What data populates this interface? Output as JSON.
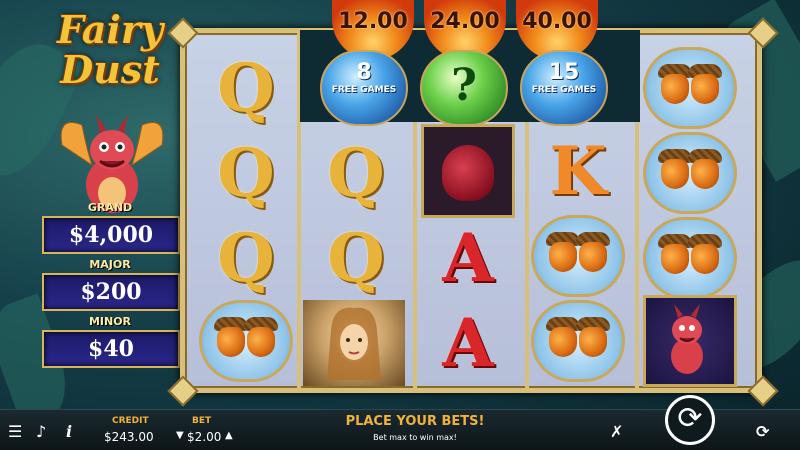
{
  "game": {
    "title_line1": "Fairy",
    "title_line2": "Dust"
  },
  "jackpots": [
    {
      "label": "GRAND",
      "value": "$4,000"
    },
    {
      "label": "MAJOR",
      "value": "$200"
    },
    {
      "label": "MINOR",
      "value": "$40"
    }
  ],
  "top_prizes": [
    "12.00",
    "24.00",
    "40.00"
  ],
  "free_games": [
    {
      "count": "8",
      "label": "FREE GAMES",
      "color": "blue"
    },
    {
      "count": "?",
      "label": "",
      "color": "green"
    },
    {
      "count": "15",
      "label": "FREE GAMES",
      "color": "blue"
    }
  ],
  "reels": [
    [
      "Q",
      "Q",
      "Q",
      "acorn"
    ],
    [
      "Q",
      "Q",
      "fairy"
    ],
    [
      "pouch",
      "A",
      "A"
    ],
    [
      "K",
      "acorn",
      "acorn"
    ],
    [
      "acorn",
      "acorn",
      "acorn",
      "dragon"
    ]
  ],
  "bottom": {
    "credit_label": "CREDIT",
    "credit_value": "$243.00",
    "bet_label": "BET",
    "bet_value": "$2.00",
    "message": "PLACE YOUR BETS!",
    "submessage": "Bet max to win max!",
    "icons": [
      "menu-icon",
      "sound-off-icon",
      "info-icon",
      "turbo-icon",
      "spin-icon",
      "autoplay-icon"
    ]
  },
  "colors": {
    "gold": "#e7b33a",
    "frame": "#d8c07a",
    "jackpot_bg": "#1d1a6a",
    "accent_orange": "#f0b23a"
  }
}
